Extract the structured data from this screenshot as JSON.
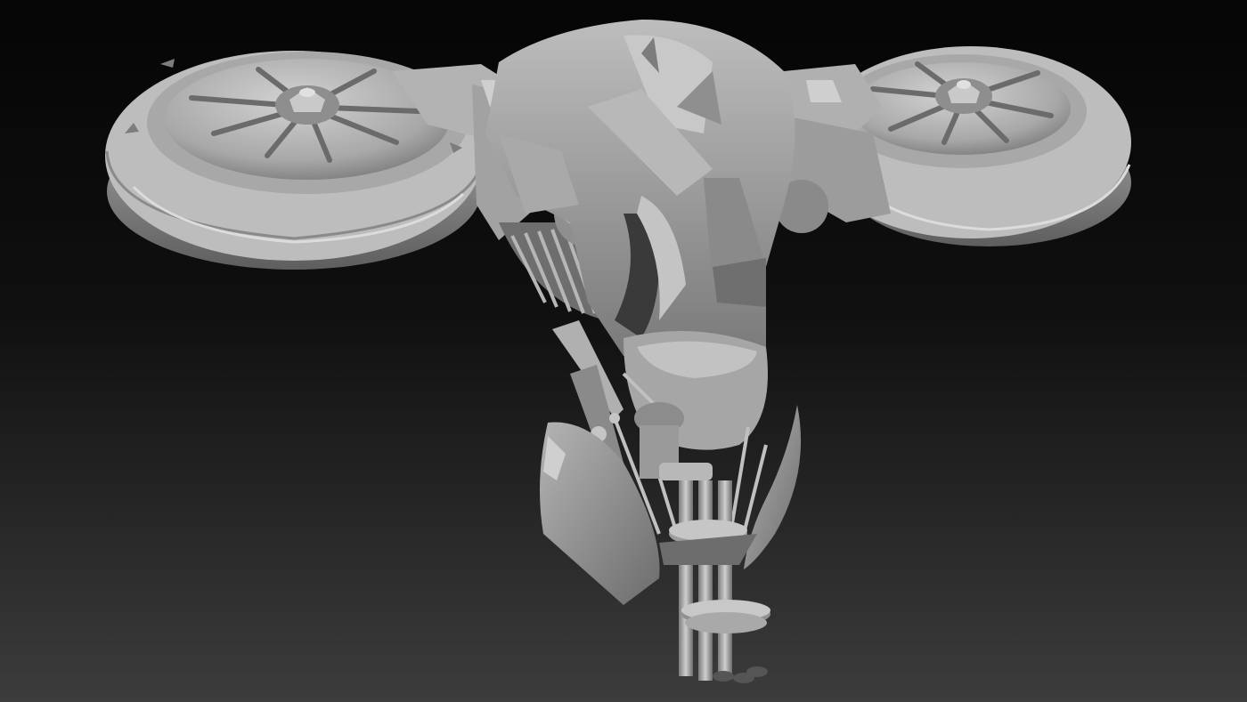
{
  "scene": {
    "subject": "drone-render-clay",
    "colors": {
      "background_top": "#050505",
      "background_bottom": "#3c3c3c",
      "clay_light": "#c6c6c6",
      "clay_mid": "#9a9a9a",
      "clay_dark": "#555555",
      "crevice": "#2a2a2a"
    }
  }
}
